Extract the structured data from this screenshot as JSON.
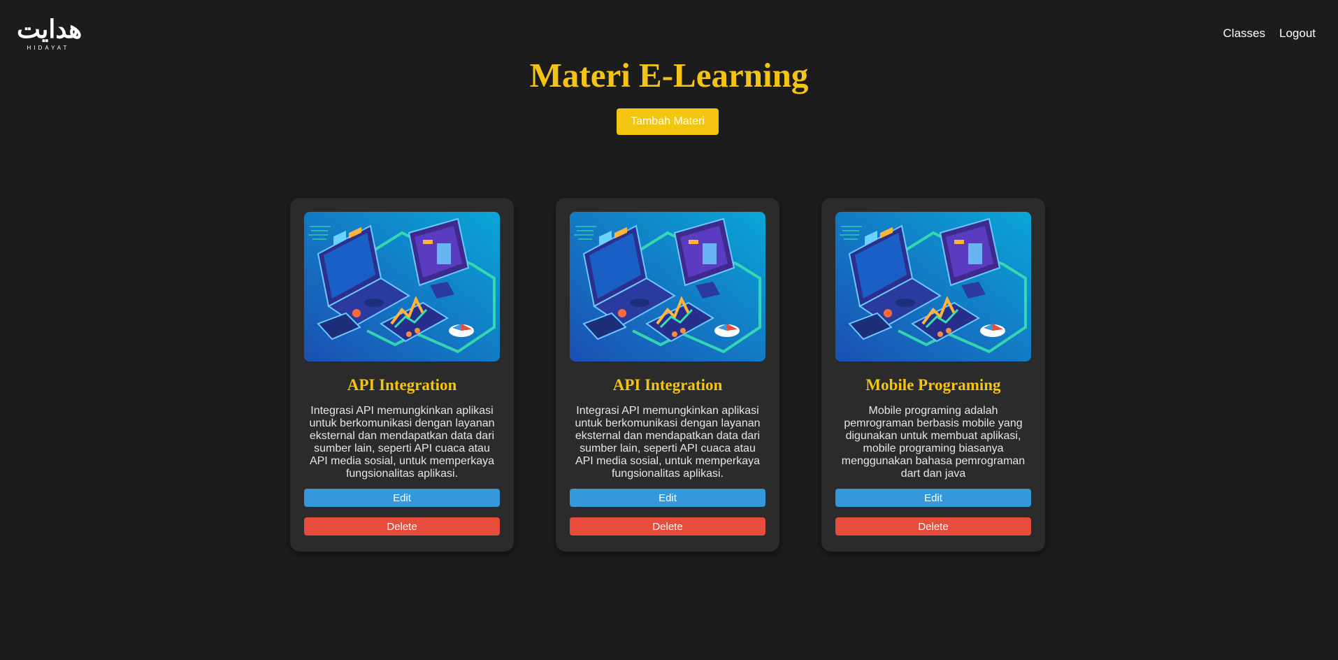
{
  "header": {
    "logo_arabic": "هدايت",
    "logo_latin": "HIDAYAT",
    "nav": [
      {
        "label": "Classes"
      },
      {
        "label": "Logout"
      }
    ]
  },
  "main": {
    "title": "Materi E-Learning",
    "add_button_label": "Tambah Materi"
  },
  "cards": [
    {
      "title": "API Integration",
      "description": "Integrasi API memungkinkan aplikasi untuk berkomunikasi dengan layanan eksternal dan mendapatkan data dari sumber lain, seperti API cuaca atau API media sosial, untuk memperkaya fungsionalitas aplikasi.",
      "edit_label": "Edit",
      "delete_label": "Delete"
    },
    {
      "title": "API Integration",
      "description": "Integrasi API memungkinkan aplikasi untuk berkomunikasi dengan layanan eksternal dan mendapatkan data dari sumber lain, seperti API cuaca atau API media sosial, untuk memperkaya fungsionalitas aplikasi.",
      "edit_label": "Edit",
      "delete_label": "Delete"
    },
    {
      "title": "Mobile Programing",
      "description": "Mobile programing adalah pemrograman berbasis mobile yang digunakan untuk membuat aplikasi, mobile programing biasanya menggunakan bahasa pemrograman dart dan java",
      "edit_label": "Edit",
      "delete_label": "Delete"
    }
  ],
  "colors": {
    "background": "#1c1c1c",
    "card": "#2b2b2b",
    "accent": "#f3c316",
    "edit": "#3498db",
    "delete": "#e74c3c"
  },
  "icons": {
    "card_image": "isometric-devices-illustration"
  }
}
